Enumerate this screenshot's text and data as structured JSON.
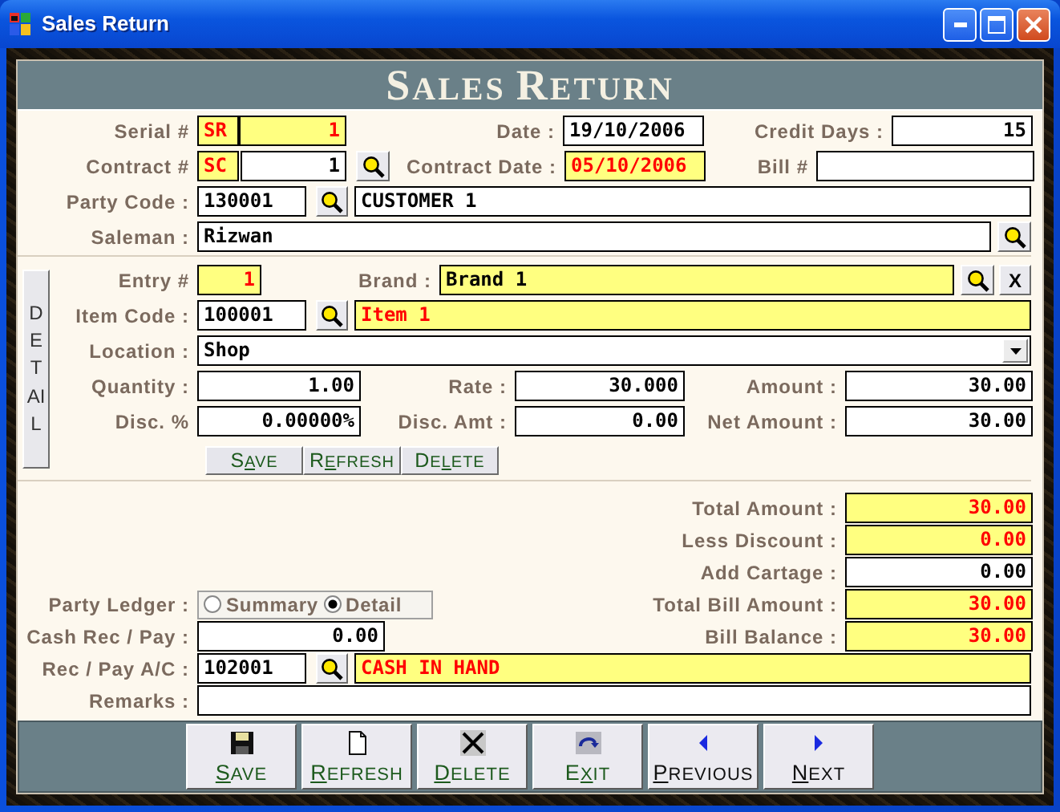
{
  "window": {
    "title": "Sales Return"
  },
  "header": {
    "title": "SALES RETURN"
  },
  "master_rows": [
    [
      {
        "kind": "label",
        "text": "Serial #"
      },
      {
        "kind": "field",
        "text": "SR",
        "highlighted": true,
        "alert": true
      },
      {
        "kind": "field",
        "text": "1",
        "highlighted": true,
        "alert": true
      },
      {
        "kind": "label",
        "text": "Date :"
      },
      {
        "kind": "field",
        "text": "19/10/2006",
        "highlighted": false,
        "alert": false
      },
      {
        "kind": "label",
        "text": "Credit Days :"
      },
      {
        "kind": "field",
        "text": "15",
        "highlighted": false,
        "alert": false
      }
    ],
    [
      {
        "kind": "label",
        "text": "Contract #"
      },
      {
        "kind": "field",
        "text": "SC",
        "highlighted": true,
        "alert": true
      },
      {
        "kind": "field",
        "text": "1",
        "highlighted": false,
        "alert": false
      },
      {
        "kind": "lookup"
      },
      {
        "kind": "label",
        "text": "Contract Date :"
      },
      {
        "kind": "field",
        "text": "05/10/2006",
        "highlighted": true,
        "alert": true
      },
      {
        "kind": "label",
        "text": "Bill #"
      },
      {
        "kind": "field",
        "highlighted": false
      }
    ],
    [
      {
        "kind": "label",
        "text": "Party Code :"
      },
      {
        "kind": "field",
        "text": "130001",
        "highlighted": false,
        "alert": false
      },
      {
        "kind": "lookup"
      },
      {
        "kind": "field",
        "text": "CUSTOMER 1",
        "highlighted": false,
        "alert": false
      }
    ],
    [
      {
        "kind": "label",
        "text": "Saleman :"
      },
      {
        "kind": "field",
        "text": "Rizwan",
        "highlighted": false,
        "alert": false
      },
      {
        "kind": "lookup"
      }
    ]
  ],
  "detail": {
    "tab": "DETAIL",
    "rows": [
      {
        "items": [
          {
            "kind": "label",
            "text": "Entry #"
          },
          {
            "kind": "field",
            "text": "1",
            "highlighted": true,
            "alert": true
          },
          {
            "kind": "label",
            "text": "Brand :"
          },
          {
            "kind": "field",
            "text": "Brand 1",
            "highlighted": true,
            "alert": false
          },
          {
            "kind": "lookup"
          },
          {
            "kind": "clear",
            "text": "X"
          }
        ]
      },
      {
        "items": [
          {
            "kind": "label",
            "text": "Item Code :"
          },
          {
            "kind": "field",
            "text": "100001",
            "highlighted": false,
            "alert": false
          },
          {
            "kind": "lookup"
          },
          {
            "kind": "field",
            "text": "Item 1",
            "highlighted": true,
            "alert": true
          }
        ]
      },
      {
        "items": [
          {
            "kind": "label",
            "text": "Location :"
          },
          {
            "kind": "select",
            "text": "Shop"
          }
        ]
      },
      {
        "items": [
          {
            "kind": "label",
            "text": "Quantity :"
          },
          {
            "kind": "field",
            "text": "1.00",
            "highlighted": false,
            "alert": false
          },
          {
            "kind": "label",
            "text": "Rate :"
          },
          {
            "kind": "field",
            "text": "30.000",
            "highlighted": false,
            "alert": false
          },
          {
            "kind": "label",
            "text": "Amount :"
          },
          {
            "kind": "field",
            "text": "30.00",
            "highlighted": false,
            "alert": false
          }
        ]
      },
      {
        "items": [
          {
            "kind": "label",
            "text": "Disc. %"
          },
          {
            "kind": "field",
            "text": "0.00000%",
            "highlighted": false,
            "alert": false
          },
          {
            "kind": "label",
            "text": "Disc. Amt :"
          },
          {
            "kind": "field",
            "text": "0.00",
            "highlighted": false,
            "alert": false
          },
          {
            "kind": "label",
            "text": "Net Amount :"
          },
          {
            "kind": "field",
            "text": "30.00",
            "highlighted": false,
            "alert": false
          }
        ]
      }
    ],
    "buttons": [
      {
        "label": "SAVE"
      },
      {
        "label": "REFRESH"
      },
      {
        "label": "DELETE"
      }
    ]
  },
  "summary_rows": [
    [
      {
        "kind": "label",
        "text": "Total Amount :"
      },
      {
        "kind": "field",
        "text": "30.00",
        "highlighted": true,
        "alert": true
      }
    ],
    [
      {
        "kind": "label",
        "text": "Less Discount :"
      },
      {
        "kind": "field",
        "text": "0.00",
        "highlighted": true,
        "alert": true
      }
    ],
    [
      {
        "kind": "label",
        "text": "Add Cartage :"
      },
      {
        "kind": "field",
        "text": "0.00",
        "highlighted": false,
        "alert": false
      }
    ],
    [
      {
        "kind": "label",
        "text": "Party Ledger :"
      },
      {
        "kind": "radio_group",
        "options": [
          {
            "label": "Summary",
            "selected": false
          },
          {
            "label": "Detail",
            "selected": true
          }
        ]
      },
      {
        "kind": "label",
        "text": "Total Bill Amount :"
      },
      {
        "kind": "field",
        "text": "30.00",
        "highlighted": true,
        "alert": true
      }
    ],
    [
      {
        "kind": "label",
        "text": "Cash Rec / Pay :"
      },
      {
        "kind": "field",
        "text": "0.00",
        "highlighted": false,
        "alert": false
      },
      {
        "kind": "label",
        "text": "Bill Balance :"
      },
      {
        "kind": "field",
        "text": "30.00",
        "highlighted": true,
        "alert": true
      }
    ],
    [
      {
        "kind": "label",
        "text": "Rec / Pay A/C :"
      },
      {
        "kind": "field",
        "text": "102001",
        "highlighted": false,
        "alert": false
      },
      {
        "kind": "lookup"
      },
      {
        "kind": "field",
        "text": "CASH IN HAND",
        "highlighted": true,
        "alert": true
      }
    ],
    [
      {
        "kind": "label",
        "text": "Remarks :"
      },
      {
        "kind": "field",
        "highlighted": false
      }
    ]
  ],
  "toolbar": [
    {
      "label": "SAVE",
      "color": "#1d5a1d"
    },
    {
      "label": "REFRESH",
      "color": "#1d5a1d"
    },
    {
      "label": "DELETE",
      "color": "#1d5a1d"
    },
    {
      "label": "EXIT",
      "color": "#1d5a1d"
    },
    {
      "label": "PREVIOUS",
      "color": "#111111"
    },
    {
      "label": "NEXT",
      "color": "#111111"
    }
  ]
}
